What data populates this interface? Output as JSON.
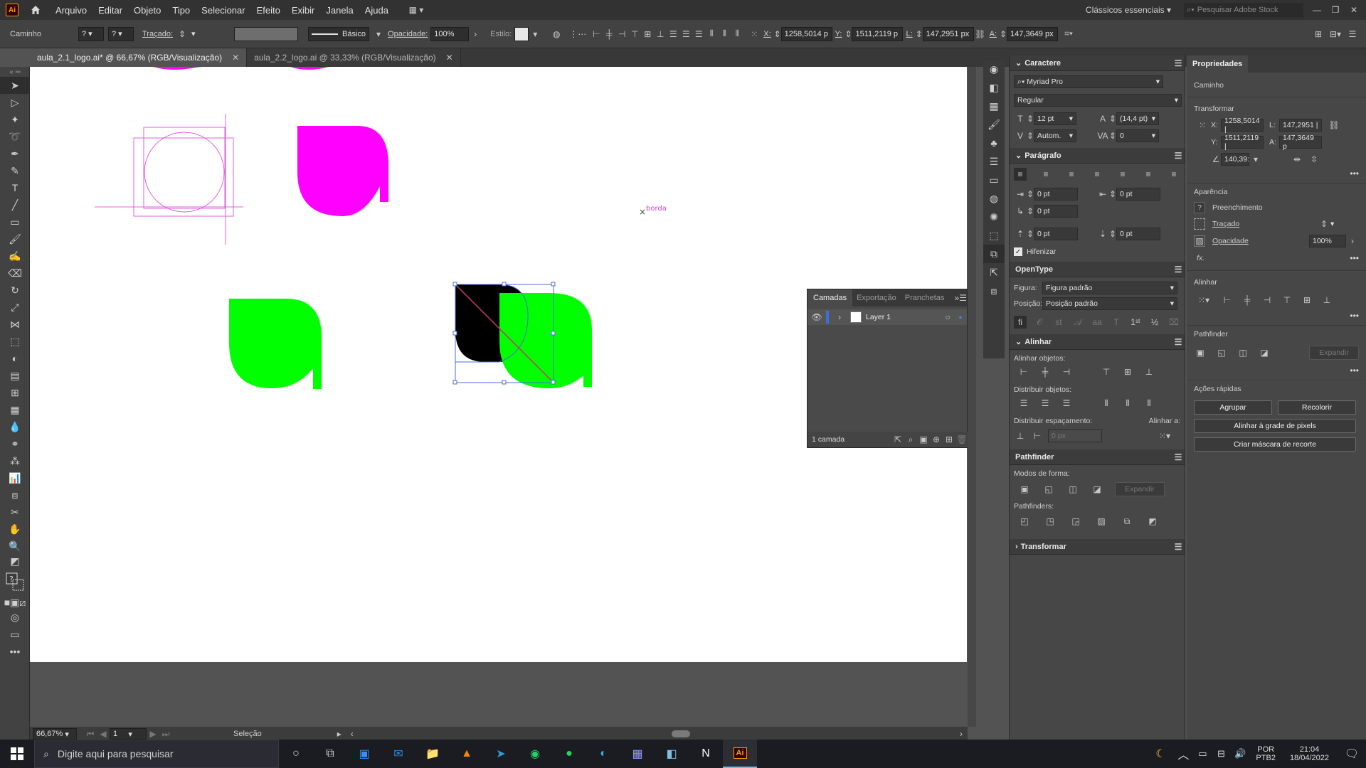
{
  "menubar": {
    "logo": "Ai",
    "items": [
      "Arquivo",
      "Editar",
      "Objeto",
      "Tipo",
      "Selecionar",
      "Efeito",
      "Exibir",
      "Janela",
      "Ajuda"
    ],
    "workspace": "Clássicos essenciais",
    "search_placeholder": "Pesquisar Adobe Stock"
  },
  "control": {
    "object_type": "Caminho",
    "stroke_label": "Traçado:",
    "stroke_style": "Básico",
    "opacity_label": "Opacidade:",
    "opacity_value": "100%",
    "style_label": "Estilo:",
    "x_label": "X:",
    "x_value": "1258,5014 p",
    "y_label": "Y:",
    "y_value": "1511,2119 p",
    "w_label": "L:",
    "w_value": "147,2951 px",
    "h_label": "A:",
    "h_value": "147,3649 px"
  },
  "tabs": [
    {
      "label": "aula_2.1_logo.ai* @ 66,67% (RGB/Visualização)",
      "active": true
    },
    {
      "label": "aula_2.2_logo.ai @ 33,33% (RGB/Visualização)",
      "active": false
    }
  ],
  "canvas": {
    "borda_label": "borda",
    "colors": {
      "magenta": "#ff00ff",
      "green": "#00ff00",
      "black": "#000000",
      "selection": "#4a6fd6"
    }
  },
  "status": {
    "zoom": "66,67%",
    "page": "1",
    "tool": "Seleção"
  },
  "layers_panel": {
    "tabs": [
      "Camadas",
      "Exportação",
      "Pranchetas"
    ],
    "layer_name": "Layer 1",
    "footer": "1 camada"
  },
  "caractere": {
    "title": "Caractere",
    "font": "Myriad Pro",
    "style": "Regular",
    "size": "12 pt",
    "leading": "(14,4 pt)",
    "kerning": "Autom.",
    "tracking": "0"
  },
  "paragrafo": {
    "title": "Parágrafo",
    "indent_left": "0 pt",
    "indent_right": "0 pt",
    "first_line": "0 pt",
    "space_before": "0 pt",
    "space_after": "0 pt",
    "hyphenate": "Hifenizar"
  },
  "opentype": {
    "title": "OpenType",
    "figure_label": "Figura:",
    "figure_value": "Figura padrão",
    "position_label": "Posição:",
    "position_value": "Posição padrão"
  },
  "alinhar": {
    "title": "Alinhar",
    "align_objects": "Alinhar objetos:",
    "distribute_objects": "Distribuir objetos:",
    "distribute_spacing": "Distribuir espaçamento:",
    "align_to": "Alinhar a:",
    "spacing_value": "0 px"
  },
  "pathfinder": {
    "title": "Pathfinder",
    "shape_modes": "Modos de forma:",
    "expand": "Expandir",
    "pathfinders": "Pathfinders:"
  },
  "transformar_panel": {
    "title": "Transformar"
  },
  "properties": {
    "title": "Propriedades",
    "object_type": "Caminho",
    "transform_title": "Transformar",
    "x_label": "X:",
    "x_value": "1258,5014 |",
    "y_label": "Y:",
    "y_value": "1511,2119 |",
    "w_label": "L:",
    "w_value": "147,2951 |",
    "h_label": "A:",
    "h_value": "147,3649 p",
    "angle_value": "140,39:",
    "appearance_title": "Aparência",
    "fill_label": "Preenchimento",
    "stroke_label": "Traçado",
    "opacity_label": "Opacidade",
    "opacity_value": "100%",
    "fx": "fx.",
    "align_title": "Alinhar",
    "pathfinder_title": "Pathfinder",
    "expand": "Expandir",
    "quick_actions_title": "Ações rápidas",
    "btn_group": "Agrupar",
    "btn_recolor": "Recolorir",
    "btn_pixel": "Alinhar à grade de pixels",
    "btn_mask": "Criar máscara de recorte"
  },
  "taskbar": {
    "search_placeholder": "Digite aqui para pesquisar",
    "lang1": "POR",
    "lang2": "PTB2",
    "time": "21:04",
    "date": "18/04/2022"
  }
}
